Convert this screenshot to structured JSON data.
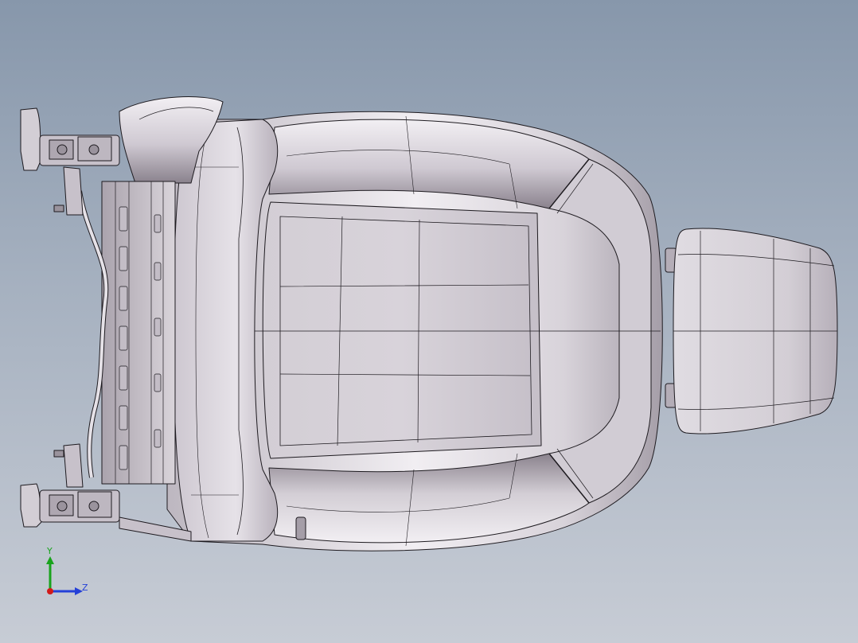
{
  "viewport": {
    "background_top": "#8797ab",
    "background_bottom": "#c7ccd5",
    "model_fill": "#d9d4da",
    "model_shade": "#9a929c",
    "edge_color": "#1e1b20"
  },
  "triad": {
    "y_label": "Y",
    "z_label": "Z",
    "y_color": "#19a31c",
    "z_color": "#2440d8",
    "x_color": "#d21a1a"
  }
}
